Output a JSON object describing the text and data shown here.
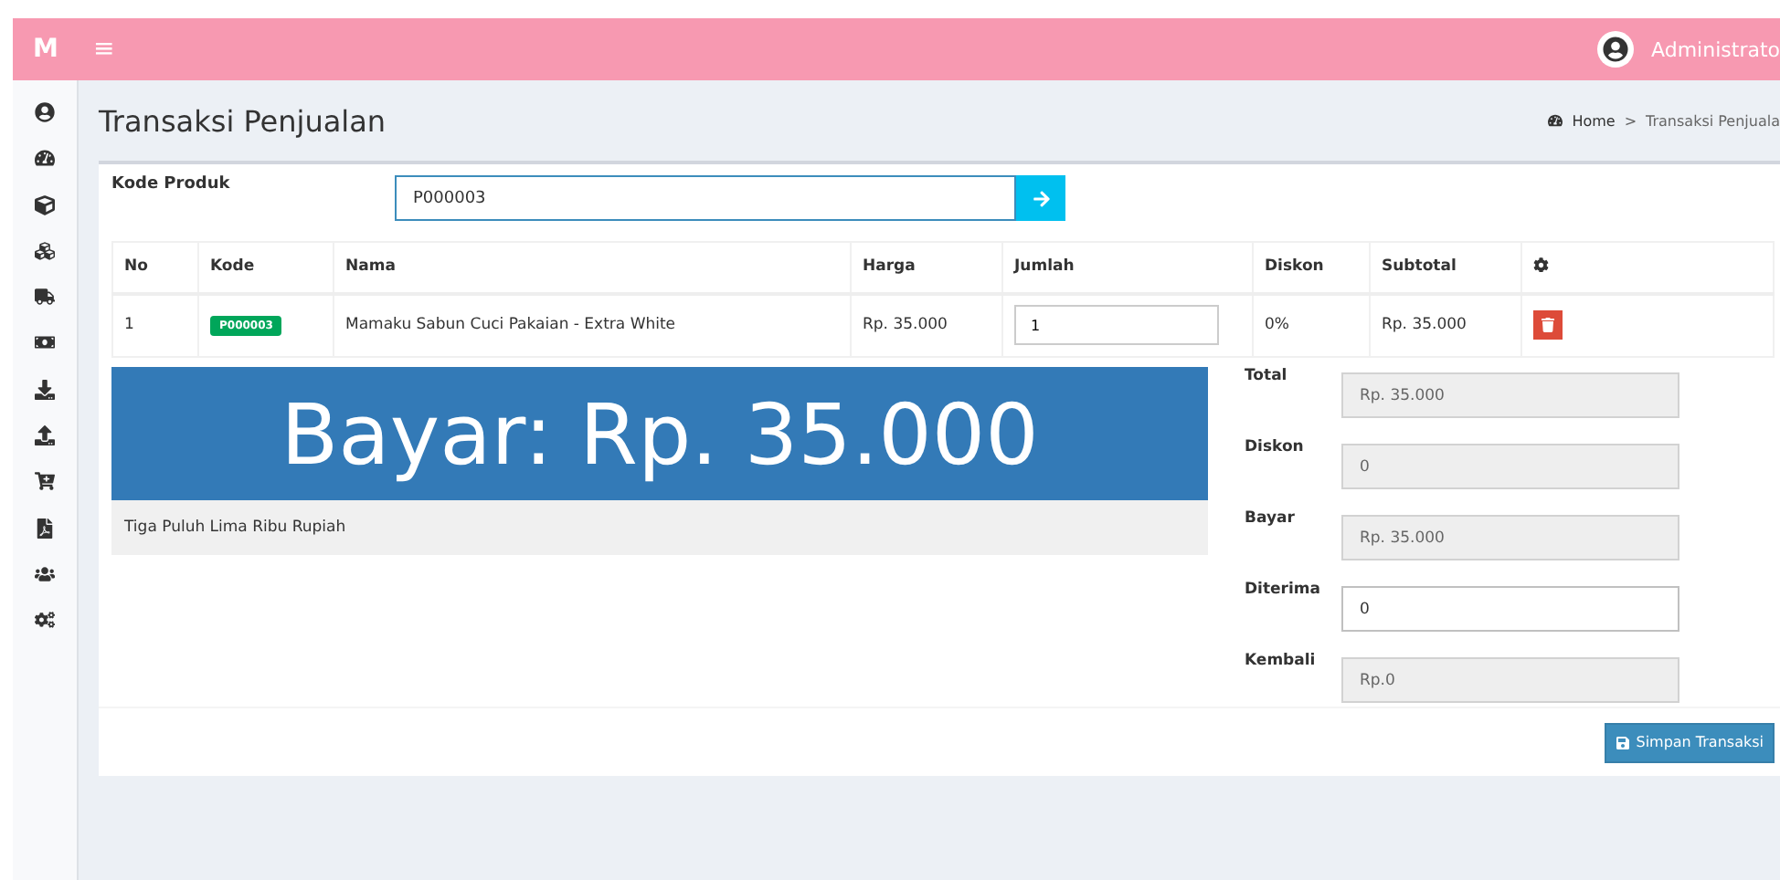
{
  "header": {
    "logo": "M",
    "menu_glyph": "≡",
    "user": "Administrato"
  },
  "page": {
    "title": "Transaksi Penjualan",
    "breadcrumb": [
      "Home",
      "Transaksi Penjuala"
    ],
    "breadcrumb_separator": ">"
  },
  "product_code": {
    "label": "Kode Produk",
    "value": "P000003"
  },
  "table": {
    "columns": [
      "No",
      "Kode",
      "Nama",
      "Harga",
      "Jumlah",
      "Diskon",
      "Subtotal"
    ],
    "rows": [
      {
        "no": "1",
        "kode": "P000003",
        "nama": "Mamaku Sabun Cuci Pakaian - Extra White",
        "harga": "Rp. 35.000",
        "jumlah": "1",
        "diskon": "0%",
        "subtotal": "Rp. 35.000"
      }
    ]
  },
  "pay_banner": {
    "text": "Bayar: Rp. 35.000",
    "in_words": "Tiga Puluh Lima Ribu Rupiah"
  },
  "summary": [
    {
      "label": "Total",
      "value": "Rp. 35.000",
      "disabled": true
    },
    {
      "label": "Diskon",
      "value": "0",
      "disabled": true
    },
    {
      "label": "Bayar",
      "value": "Rp. 35.000",
      "disabled": true
    },
    {
      "label": "Diterima",
      "value": "0",
      "disabled": false
    },
    {
      "label": "Kembali",
      "value": "Rp.0",
      "disabled": true
    }
  ],
  "save_button": "Simpan Transaksi"
}
